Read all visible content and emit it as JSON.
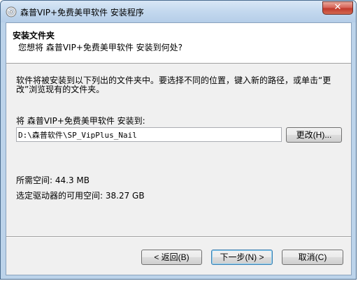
{
  "window": {
    "title": "森普VIP+免费美甲软件 安装程序",
    "close_glyph": "✕",
    "app_icon": "installer-cd-icon"
  },
  "header": {
    "title": "安装文件夹",
    "subtitle": "您想将 森普VIP+免费美甲软件 安装到何处?"
  },
  "body": {
    "description": "软件将被安装到以下列出的文件夹中。要选择不同的位置，键入新的路径，或单击“更改”浏览现有的文件夹。",
    "install_label": "将 森普VIP+免费美甲软件 安装到:",
    "install_path": "D:\\森普软件\\SP_VipPlus_Nail",
    "change_button": "更改(H)...",
    "required_space": "所需空间: 44.3 MB",
    "available_space": "选定驱动器的可用空间: 38.27 GB"
  },
  "footer": {
    "back_button": "< 返回(B)",
    "next_button": "下一步(N) >",
    "cancel_button": "取消(C)"
  },
  "colors": {
    "frame": "#bcd3ea",
    "close_button": "#c13a2c",
    "default_button_border": "#3c7fb1"
  }
}
